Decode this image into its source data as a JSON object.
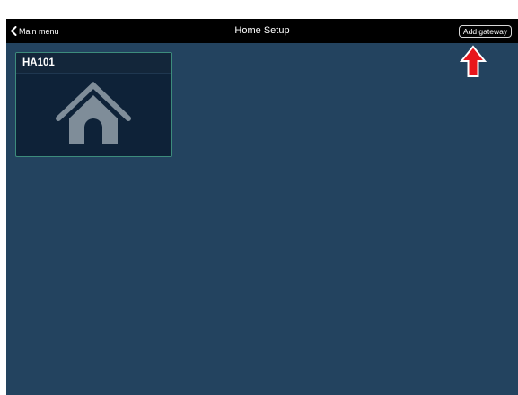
{
  "navbar": {
    "back_label": "Main menu",
    "back_icon": "chevron-left-icon",
    "title": "Home Setup",
    "add_gateway_label": "Add gateway"
  },
  "gateways": [
    {
      "name": "HA101",
      "icon": "home-icon"
    }
  ],
  "annotation": {
    "icon": "arrow-up-icon",
    "color": "#e8161b"
  },
  "colors": {
    "background": "#23435f",
    "navbar": "#000000",
    "tile": "#0e2238",
    "tile_border": "#3d8c7c",
    "icon": "#7f8d99"
  }
}
